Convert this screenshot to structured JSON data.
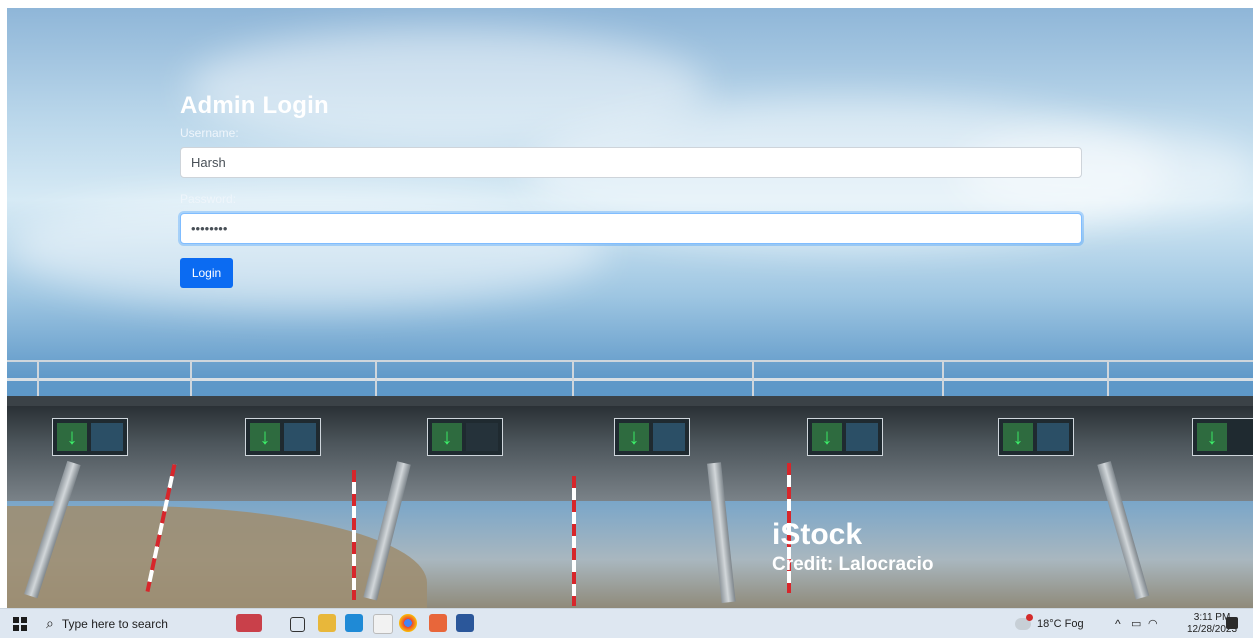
{
  "login": {
    "title": "Admin Login",
    "username_label": "Username:",
    "username_value": "Harsh",
    "password_label": "Password:",
    "password_value": "••••••••",
    "button_label": "Login"
  },
  "watermark": {
    "brand": "iStock",
    "credit": "Credit: Lalocracio"
  },
  "taskbar": {
    "search_placeholder": "Type here to search",
    "weather": "18°C Fog",
    "time": "3:11 PM",
    "date": "12/28/2023"
  }
}
